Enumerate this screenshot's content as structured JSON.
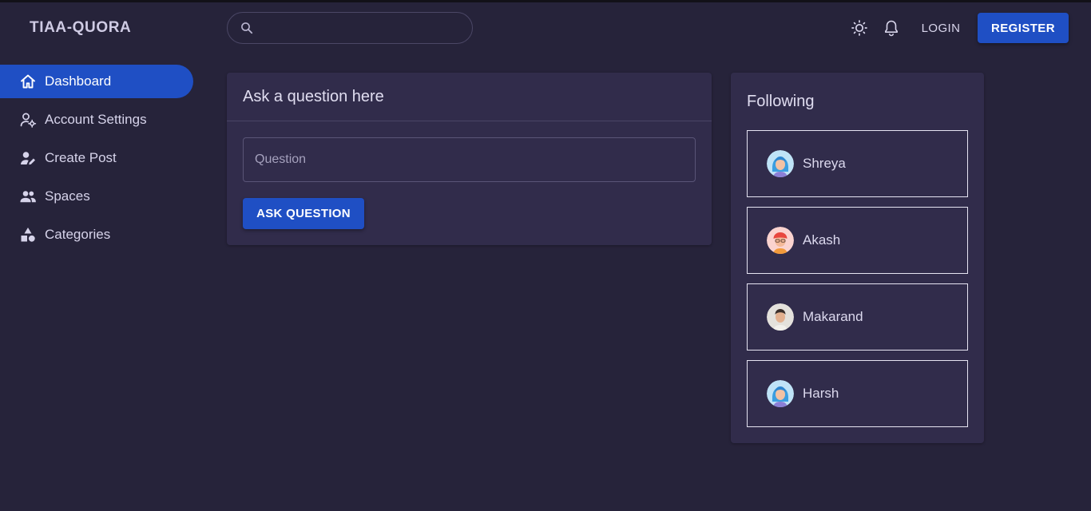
{
  "header": {
    "logo": "TIAA-QUORA",
    "search": {
      "placeholder": "",
      "value": ""
    },
    "icons": [
      "theme-toggle-icon",
      "notification-bell-icon",
      "search-icon"
    ],
    "login_label": "LOGIN",
    "register_label": "REGISTER"
  },
  "sidebar": {
    "items": [
      {
        "label": "Dashboard",
        "icon": "home-icon",
        "active": true
      },
      {
        "label": "Account Settings",
        "icon": "account-settings-icon",
        "active": false
      },
      {
        "label": "Create Post",
        "icon": "edit-person-icon",
        "active": false
      },
      {
        "label": "Spaces",
        "icon": "group-icon",
        "active": false
      },
      {
        "label": "Categories",
        "icon": "category-shapes-icon",
        "active": false
      }
    ]
  },
  "ask": {
    "title": "Ask a question here",
    "question_placeholder": "Question",
    "button_label": "ASK QUESTION"
  },
  "following": {
    "title": "Following",
    "users": [
      {
        "name": "Shreya",
        "avatar": "avatar-blue-hair"
      },
      {
        "name": "Akash",
        "avatar": "avatar-red-cap"
      },
      {
        "name": "Makarand",
        "avatar": "avatar-dark-hair"
      },
      {
        "name": "Harsh",
        "avatar": "avatar-blue-hair"
      }
    ]
  },
  "colors": {
    "background": "#26233a",
    "card": "#312c4b",
    "accent": "#1f4fc4",
    "text": "#d9d6ec"
  }
}
